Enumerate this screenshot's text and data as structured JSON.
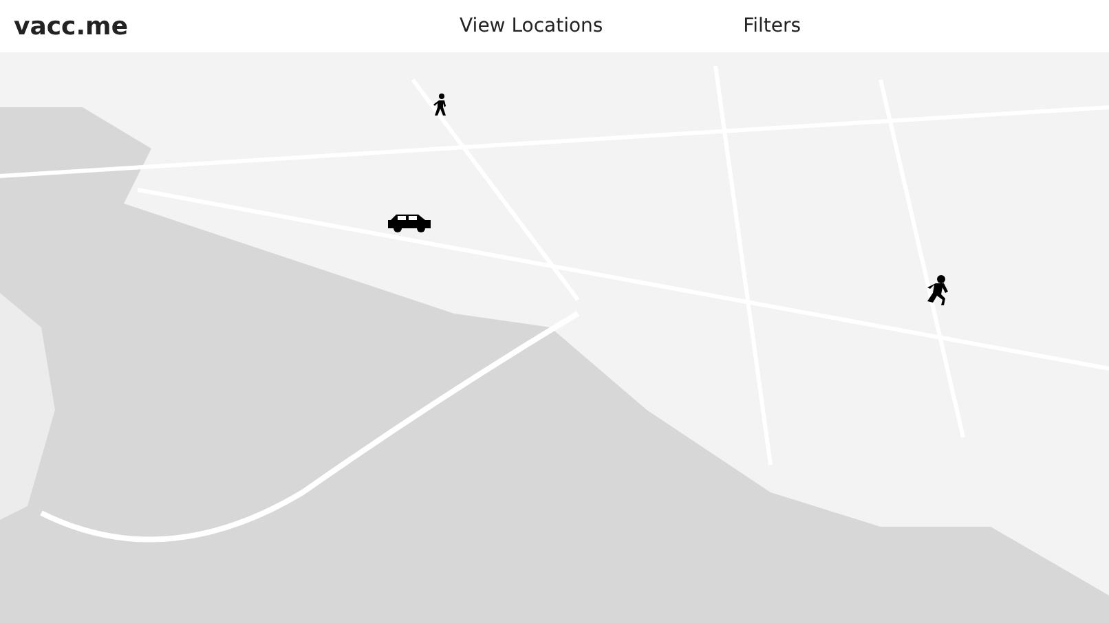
{
  "navbar": {
    "brand": "vacc.me",
    "links": [
      {
        "label": "View Locations"
      },
      {
        "label": "Filters"
      }
    ]
  },
  "map": {
    "markers": [
      {
        "kind": "walker"
      },
      {
        "kind": "car"
      },
      {
        "kind": "runner"
      }
    ]
  }
}
